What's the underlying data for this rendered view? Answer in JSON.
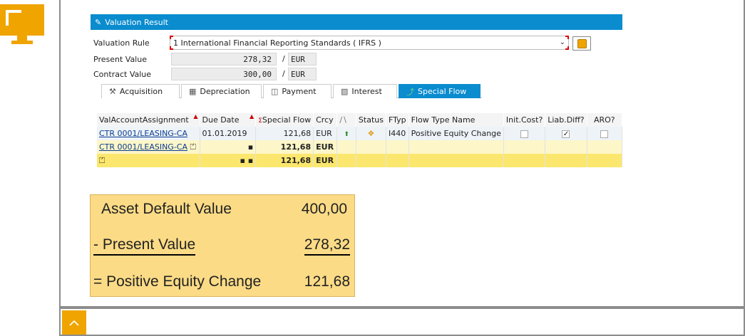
{
  "panel": {
    "title": "Valuation Result"
  },
  "fields": {
    "valuation_rule_label": "Valuation Rule",
    "valuation_rule_value": "1 International Financial Reporting Standards ( IFRS )",
    "present_value_label": "Present Value",
    "present_value": "278,32",
    "present_value_currency": "EUR",
    "contract_value_label": "Contract Value",
    "contract_value": "300,00",
    "contract_value_currency": "EUR",
    "slash": "/"
  },
  "tabs": [
    {
      "label": "Acquisition",
      "icon": "acquisition-icon"
    },
    {
      "label": "Depreciation",
      "icon": "depreciation-icon"
    },
    {
      "label": "Payment",
      "icon": "payment-icon"
    },
    {
      "label": "Interest",
      "icon": "interest-icon"
    },
    {
      "label": "Special Flow",
      "icon": "special-flow-icon",
      "active": true
    }
  ],
  "grid": {
    "headers": [
      "ValAccountAssignment",
      "Due Date",
      "Special Flow",
      "Crcy",
      "",
      "Status",
      "FTyp",
      "Flow Type Name",
      "Init.Cost?",
      "Liab.Diff?",
      "ARO?"
    ],
    "row1": {
      "assignment": "CTR 0001/LEASING-CA",
      "due_date": "01.01.2019",
      "special_flow": "121,68",
      "crcy": "EUR",
      "ftyp": "I440",
      "flow_type_name": "Positive Equity Change",
      "init_cost": false,
      "liab_diff": true,
      "aro": false
    },
    "row2": {
      "assignment": "CTR 0001/LEASING-CA",
      "marker": "▪",
      "special_flow": "121,68",
      "crcy": "EUR"
    },
    "row3": {
      "marker": "▪ ▪",
      "special_flow": "121,68",
      "crcy": "EUR"
    }
  },
  "calc": {
    "line1_label": "Asset Default Value",
    "line1_value": "400,00",
    "line2_label": "- Present Value",
    "line2_value": "278,32",
    "line3_label": "= Positive Equity Change",
    "line3_value": "121,68"
  },
  "colors": {
    "sap_blue": "#0a8ccf",
    "accent_orange": "#f0a400",
    "calc_fill": "#fbdb86",
    "total_row": "#fce76e"
  }
}
